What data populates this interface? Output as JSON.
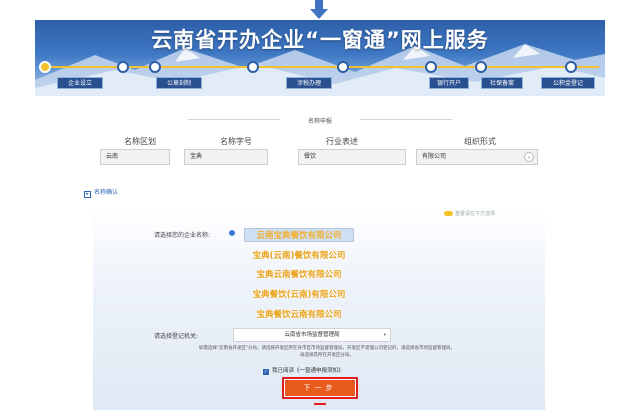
{
  "banner": {
    "title": "云南省开办企业“一窗通”网上服务",
    "steps": [
      "企业设立",
      "公章刻制",
      "涉税办理",
      "银行开户",
      "社保备案",
      "公积金登记"
    ]
  },
  "name_section": {
    "title": "名称申报",
    "columns": [
      "名称区划",
      "名称字号",
      "行业表述",
      "组织形式"
    ],
    "values": [
      "云南",
      "宝典",
      "餐饮",
      "有限公司"
    ]
  },
  "confirm": {
    "label": "名称确认"
  },
  "toggle_text": "重置请在下方选择",
  "choose_name": {
    "label": "请选择您的企业名称:",
    "options": [
      "云南宝典餐饮有限公司",
      "宝典(云南)餐饮有限公司",
      "宝典云南餐饮有限公司",
      "宝典餐饮(云南)有限公司",
      "宝典餐饮云南有限公司"
    ],
    "selected_prefix": "云南"
  },
  "registry": {
    "label": "请选择登记机关:",
    "value": "云南省市场监督管理局"
  },
  "notice": "如需选择\"云南省开发区\"分局，请选择开发区所在县市区市场监督管理局，开发区不受理公司登记的，请选择省市场监督管理局，再选择其所在开发区分局。",
  "agreement": "我已阅读《一窗通申报须知》",
  "next_button": "下一步",
  "colors": {
    "accent": "#e85a1e",
    "banner": "#2d5fa8",
    "name_gold": "#e8a21a"
  }
}
